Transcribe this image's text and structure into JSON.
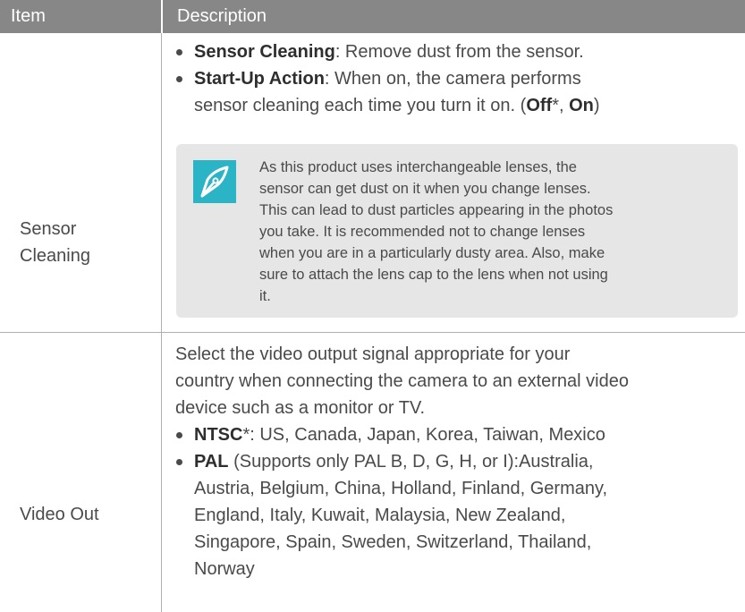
{
  "header": {
    "item": "Item",
    "description": "Description"
  },
  "rows": [
    {
      "label": [
        "Sensor",
        "Cleaning"
      ],
      "bullets": [
        {
          "bold": "Sensor Cleaning",
          "text": ": Remove dust from the sensor."
        },
        {
          "bold": "Start-Up Action",
          "text_lines": [
            ": When on, the camera performs",
            "sensor cleaning each time you turn it on. ("
          ],
          "opt1": "Off",
          "star": "*",
          "comma": ", ",
          "opt2": "On",
          "close": ")"
        }
      ],
      "note": {
        "icon": "pen-nib-icon",
        "lines": [
          "As this product uses interchangeable lenses, the",
          "sensor can get dust on it when you change lenses.",
          "This can lead to dust particles appearing in the photos",
          "you take. It is recommended not to change lenses",
          "when you are in a particularly dusty area. Also, make",
          "sure to attach the lens cap to the lens when not using",
          "it."
        ]
      }
    },
    {
      "label": [
        "Video Out"
      ],
      "intro": [
        "Select the video output signal appropriate for your",
        "country when connecting the camera to an external video",
        "device such as a monitor or TV."
      ],
      "bullets": [
        {
          "bold": "NTSC",
          "star": "*",
          "text": ": US, Canada, Japan, Korea, Taiwan, Mexico"
        },
        {
          "bold": "PAL",
          "text_lines": [
            " (Supports only PAL B, D, G, H, or I):Australia,",
            "Austria, Belgium, China, Holland, Finland, Germany,",
            "England, Italy, Kuwait, Malaysia, New Zealand,",
            "Singapore, Spain, Sweden, Switzerland, Thailand,",
            "Norway"
          ]
        }
      ]
    }
  ],
  "colors": {
    "header_bg": "#878787",
    "note_bg": "#e6e6e6",
    "icon_accent": "#2bb3c6"
  }
}
